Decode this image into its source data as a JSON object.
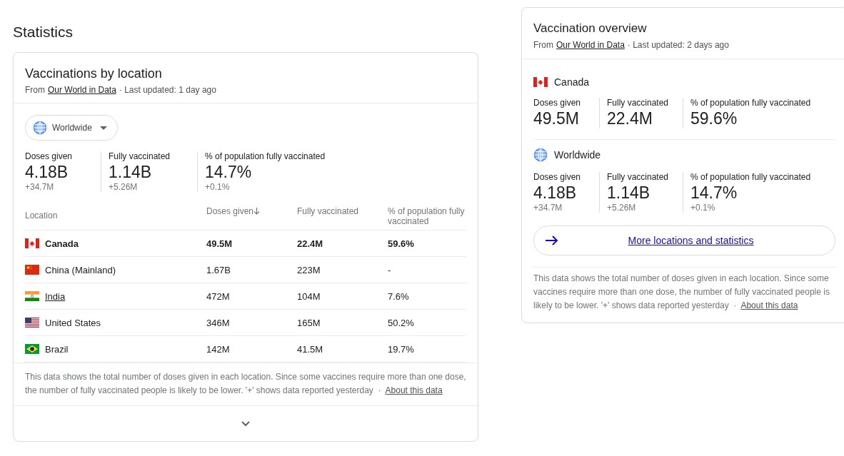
{
  "page_title": "Statistics",
  "location_card": {
    "title": "Vaccinations by location",
    "source_prefix": "From",
    "source_link": "Our World in Data",
    "updated": "· Last updated: 1 day ago",
    "dropdown": {
      "label": "Worldwide"
    },
    "stats": [
      {
        "label": "Doses given",
        "value": "4.18B",
        "delta": "+34.7M"
      },
      {
        "label": "Fully vaccinated",
        "value": "1.14B",
        "delta": "+5.26M"
      },
      {
        "label": "% of population fully vaccinated",
        "value": "14.7%",
        "delta": "+0.1%"
      }
    ],
    "table": {
      "columns": [
        {
          "label": "Location",
          "sorted": false
        },
        {
          "label": "Doses given",
          "sorted": true
        },
        {
          "label": "Fully vaccinated",
          "sorted": false
        },
        {
          "label": "% of population fully vaccinated",
          "sorted": false
        }
      ],
      "rows": [
        {
          "link": false,
          "selected": true,
          "cells": [
            "Canada",
            "49.5M",
            "22.4M",
            "59.6%"
          ]
        },
        {
          "link": false,
          "selected": false,
          "cells": [
            "China (Mainland)",
            "1.67B",
            "223M",
            "-"
          ]
        },
        {
          "link": true,
          "selected": false,
          "cells": [
            "India",
            "472M",
            "104M",
            "7.6%"
          ]
        },
        {
          "link": false,
          "selected": false,
          "cells": [
            "United States",
            "346M",
            "165M",
            "50.2%"
          ]
        },
        {
          "link": false,
          "selected": false,
          "cells": [
            "Brazil",
            "142M",
            "41.5M",
            "19.7%"
          ]
        }
      ]
    },
    "note": "This data shows the total number of doses given in each location. Since some vaccines require more than one dose, the number of fully vaccinated people is likely to be lower. '+' shows data reported yesterday",
    "note_sep": "·",
    "note_link": "About this data"
  },
  "overview_card": {
    "title": "Vaccination overview",
    "source_prefix": "From",
    "source_link": "Our World in Data",
    "updated": "· Last updated: 2 days ago",
    "sections": [
      {
        "name": "Canada",
        "stats": [
          {
            "label": "Doses given",
            "value": "49.5M"
          },
          {
            "label": "Fully vaccinated",
            "value": "22.4M"
          },
          {
            "label": "% of population fully vaccinated",
            "value": "59.6%"
          }
        ]
      },
      {
        "name": "Worldwide",
        "stats": [
          {
            "label": "Doses given",
            "value": "4.18B",
            "delta": "+34.7M"
          },
          {
            "label": "Fully vaccinated",
            "value": "1.14B",
            "delta": "+5.26M"
          },
          {
            "label": "% of population fully vaccinated",
            "value": "14.7%",
            "delta": "+0.1%"
          }
        ]
      }
    ],
    "more_button": "More locations and statistics",
    "note": "This data shows the total number of doses given in each location. Since some vaccines require more than one dose, the number of fully vaccinated people is likely to be lower. '+' shows data reported yesterday",
    "note_sep": "·",
    "note_link": "About this data"
  }
}
